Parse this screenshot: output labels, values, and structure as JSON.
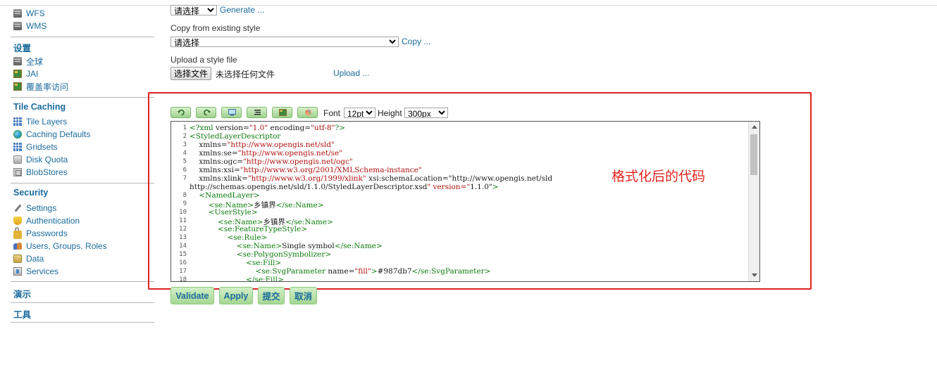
{
  "sidebar": {
    "services_items": [
      {
        "label": "WFS",
        "icon": "server-icon"
      },
      {
        "label": "WMS",
        "icon": "server-icon"
      }
    ],
    "settings": {
      "title": "设置",
      "items": [
        {
          "label": "全球",
          "icon": "server-icon"
        },
        {
          "label": "JAI",
          "icon": "image-icon"
        },
        {
          "label": "覆盖率访问",
          "icon": "image-icon"
        }
      ]
    },
    "tile_caching": {
      "title": "Tile Caching",
      "items": [
        {
          "label": "Tile Layers",
          "icon": "grid-icon"
        },
        {
          "label": "Caching Defaults",
          "icon": "globe-icon"
        },
        {
          "label": "Gridsets",
          "icon": "grid-icon"
        },
        {
          "label": "Disk Quota",
          "icon": "disk-icon"
        },
        {
          "label": "BlobStores",
          "icon": "blobstore-icon"
        }
      ]
    },
    "security": {
      "title": "Security",
      "items": [
        {
          "label": "Settings",
          "icon": "wrench-icon"
        },
        {
          "label": "Authentication",
          "icon": "shield-icon"
        },
        {
          "label": "Passwords",
          "icon": "lock-icon"
        },
        {
          "label": "Users, Groups, Roles",
          "icon": "users-icon"
        },
        {
          "label": "Data",
          "icon": "data-icon"
        },
        {
          "label": "Services",
          "icon": "services-icon"
        }
      ]
    },
    "demo_title": "演示",
    "tools_title": "工具"
  },
  "main": {
    "generate": {
      "select_value": "请选择",
      "link": "Generate ..."
    },
    "copy_style": {
      "label": "Copy from existing style",
      "select_value": "请选择",
      "link": "Copy ..."
    },
    "upload": {
      "label": "Upload a style file",
      "choose_button": "选择文件",
      "no_file": "未选择任何文件",
      "link": "Upload ..."
    },
    "toolbar": {
      "icons": [
        "undo-icon",
        "redo-icon",
        "goto-line-icon",
        "reformat-icon",
        "image-icon",
        "color-picker-icon"
      ],
      "font_label": "Font",
      "font_value": "12pt",
      "height_label": "Height",
      "height_value": "300px"
    },
    "code_lines": [
      {
        "n": "1",
        "t": "<?xml version=\"1.0\" encoding=\"utf-8\"?>"
      },
      {
        "n": "2",
        "t": "<StyledLayerDescriptor"
      },
      {
        "n": "3",
        "t": "    xmlns=\"http://www.opengis.net/sld\""
      },
      {
        "n": "4",
        "t": "    xmlns:se=\"http://www.opengis.net/se\""
      },
      {
        "n": "5",
        "t": "    xmlns:ogc=\"http://www.opengis.net/ogc\""
      },
      {
        "n": "6",
        "t": "    xmlns:xsi=\"http://www.w3.org/2001/XMLSchema-instance\""
      },
      {
        "n": "7",
        "t": "    xmlns:xlink=\"http://www.w3.org/1999/xlink\" xsi:schemaLocation=\"http://www.opengis.net/sld"
      },
      {
        "n": "",
        "t": "http://schemas.opengis.net/sld/1.1.0/StyledLayerDescriptor.xsd\" version=\"1.1.0\">"
      },
      {
        "n": "8",
        "t": "    <NamedLayer>"
      },
      {
        "n": "9",
        "t": "        <se:Name>乡镇界</se:Name>"
      },
      {
        "n": "10",
        "t": "        <UserStyle>"
      },
      {
        "n": "11",
        "t": "            <se:Name>乡镇界</se:Name>"
      },
      {
        "n": "12",
        "t": "            <se:FeatureTypeStyle>"
      },
      {
        "n": "13",
        "t": "                <se:Rule>"
      },
      {
        "n": "14",
        "t": "                    <se:Name>Single symbol</se:Name>"
      },
      {
        "n": "15",
        "t": "                    <se:PolygonSymbolizer>"
      },
      {
        "n": "16",
        "t": "                        <se:Fill>"
      },
      {
        "n": "17",
        "t": "                            <se:SvgParameter name=\"fill\">#987db7</se:SvgParameter>"
      },
      {
        "n": "18",
        "t": "                        </se:Fill>"
      }
    ],
    "annotation": "格式化后的代码",
    "actions": {
      "validate": "Validate",
      "apply": "Apply",
      "submit": "提交",
      "cancel": "取消"
    }
  }
}
